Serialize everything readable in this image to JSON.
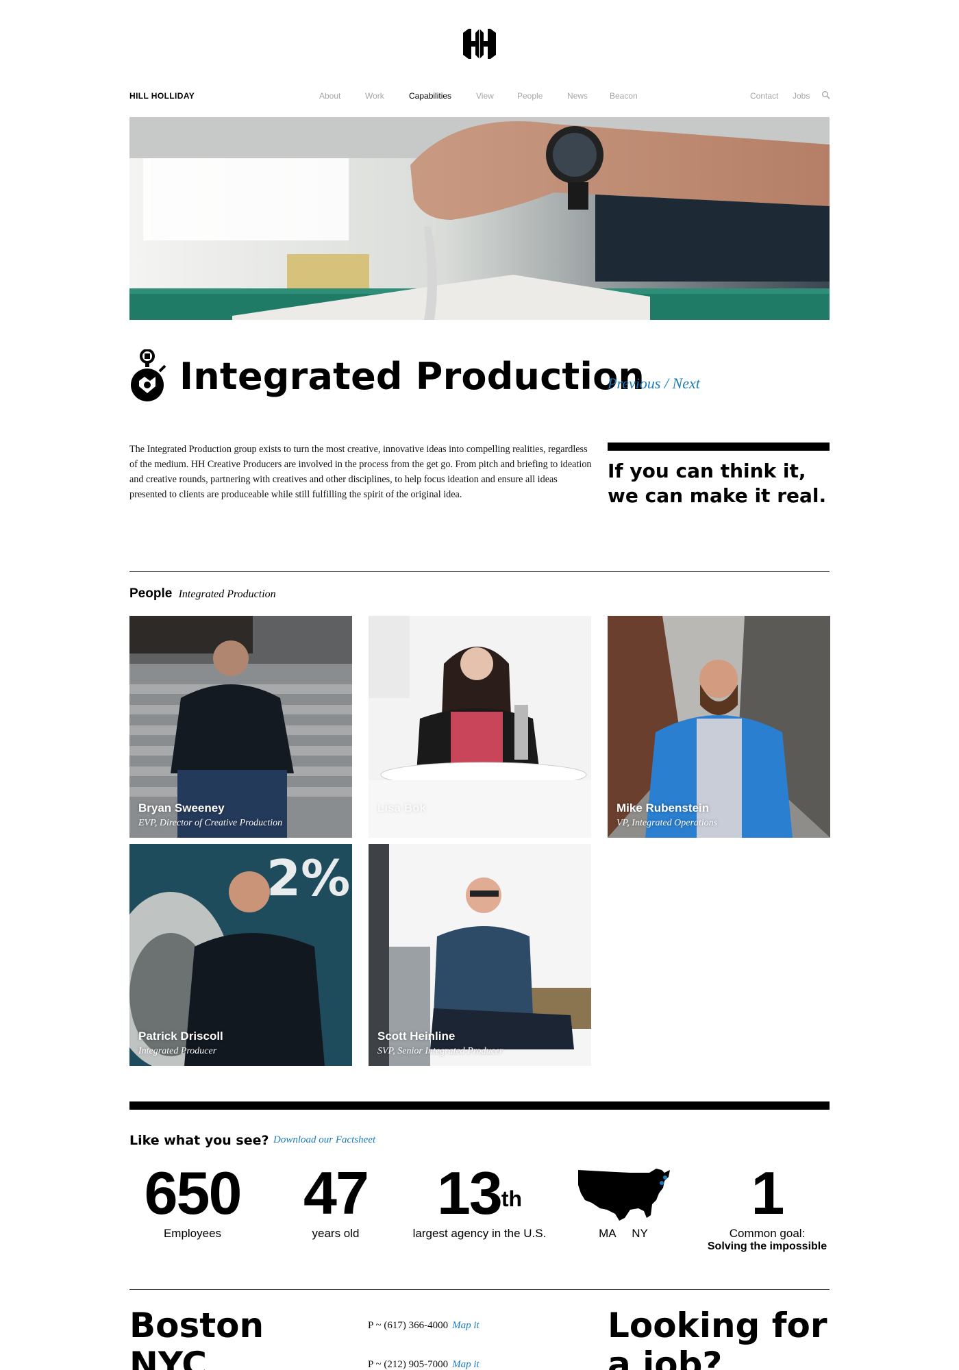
{
  "header": {
    "brand": "HILL HOLLIDAY",
    "nav": [
      "About",
      "Work",
      "Capabilities",
      "View",
      "People",
      "News",
      "Beacon"
    ],
    "active_nav": "Capabilities",
    "utility": [
      "Contact",
      "Jobs"
    ],
    "icons": {
      "logo": "hh-logo-icon",
      "search": "search-icon"
    }
  },
  "page": {
    "title": "Integrated Production",
    "previous": "Previous",
    "separator": "/",
    "next": "Next",
    "intro": "The Integrated Production group exists to turn the most creative, innovative ideas into compelling realities, regardless of the medium. HH Creative Producers are involved in the process from the get go. From pitch and briefing to ideation and creative rounds, partnering with creatives and other disciplines, to help focus ideation and ensure all ideas presented to clients are produceable while still fulfilling the spirit of the original idea.",
    "quote": "If you can think it, we can make it real."
  },
  "people": {
    "heading": "People",
    "subheading": "Integrated Production",
    "members": [
      {
        "name": "Bryan Sweeney",
        "role": "EVP, Director of Creative Production"
      },
      {
        "name": "Lisa Bok",
        "role": ""
      },
      {
        "name": "Mike Rubenstein",
        "role": "VP, Integrated Operations"
      },
      {
        "name": "Patrick Driscoll",
        "role": "Integrated Producer"
      },
      {
        "name": "Scott Heinline",
        "role": "SVP, Senior Integrated Producer"
      }
    ]
  },
  "stats": {
    "heading": "Like what you see?",
    "factsheet": "Download our Factsheet",
    "items": [
      {
        "value": "650",
        "label": "Employees"
      },
      {
        "value": "47",
        "label": "years old"
      },
      {
        "value": "13",
        "suffix": "th",
        "label": "largest agency in the U.S."
      },
      {
        "value": "",
        "label": "MA     NY"
      },
      {
        "value": "1",
        "label": "Common goal:",
        "sub": "Solving the impossible"
      }
    ]
  },
  "footer": {
    "cities": [
      {
        "name": "Boston",
        "phone": "P ~ (617) 366-4000",
        "map": "Map it"
      },
      {
        "name": "NYC",
        "phone": "P ~ (212) 905-7000",
        "map": "Map it"
      }
    ],
    "jobs_heading_1": "Looking for",
    "jobs_heading_2": "a job?"
  },
  "colors": {
    "link": "#1a7bbd",
    "nav_inactive": "#a6a6a6",
    "text": "#000000"
  }
}
